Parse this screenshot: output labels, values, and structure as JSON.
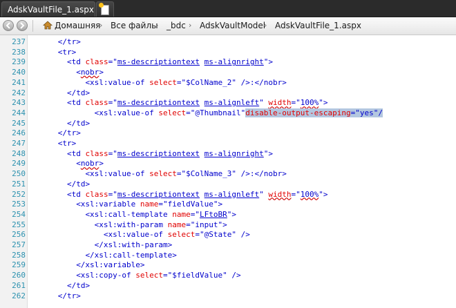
{
  "tabs": {
    "active_label": "AdskVaultFile_1.aspx *"
  },
  "breadcrumb": {
    "items": [
      "Домашняя",
      "Все файлы",
      "_bdc",
      "AdskVaultModel",
      "AdskVaultFile_1.aspx"
    ]
  },
  "colors": {
    "tag": "#0000cc",
    "attribute": "#e00000",
    "line_number": "#2b91af",
    "selection": "#b3c7e0"
  },
  "editor": {
    "lines": [
      {
        "n": "237",
        "segs": [
          [
            "t",
            "</tr>"
          ]
        ]
      },
      {
        "n": "238",
        "segs": [
          [
            "t",
            "<tr>"
          ]
        ]
      },
      {
        "n": "239",
        "segs": [
          [
            "t",
            "<td "
          ],
          [
            "a",
            "class"
          ],
          [
            "t",
            "=\""
          ],
          [
            "vu",
            "ms-descriptiontext"
          ],
          [
            "v",
            " "
          ],
          [
            "vu",
            "ms-alignright"
          ],
          [
            "t",
            "\">"
          ]
        ]
      },
      {
        "n": "240",
        "segs": [
          [
            "t",
            "<"
          ],
          [
            "tq",
            "nobr"
          ],
          [
            "t",
            ">"
          ]
        ]
      },
      {
        "n": "241",
        "segs": [
          [
            "t",
            "<xsl:value-of "
          ],
          [
            "a",
            "select"
          ],
          [
            "t",
            "=\""
          ],
          [
            "v",
            "$ColName_2"
          ],
          [
            "t",
            "\" />:</nobr>"
          ]
        ]
      },
      {
        "n": "242",
        "segs": [
          [
            "t",
            "</td>"
          ]
        ]
      },
      {
        "n": "243",
        "segs": [
          [
            "t",
            "<td "
          ],
          [
            "a",
            "class"
          ],
          [
            "t",
            "=\""
          ],
          [
            "vu",
            "ms-descriptiontext"
          ],
          [
            "v",
            " "
          ],
          [
            "vu",
            "ms-alignleft"
          ],
          [
            "t",
            "\" "
          ],
          [
            "aq",
            "width"
          ],
          [
            "t",
            "=\""
          ],
          [
            "vq",
            "100%"
          ],
          [
            "t",
            "\">"
          ]
        ]
      },
      {
        "n": "244",
        "segs": [
          [
            "t",
            "<xsl:value-of "
          ],
          [
            "a",
            "select"
          ],
          [
            "t",
            "=\""
          ],
          [
            "v",
            "@Thumbnail"
          ],
          [
            "t",
            "\""
          ],
          [
            "as",
            "disable-output-escaping"
          ],
          [
            "ts",
            "=\""
          ],
          [
            "vs",
            "yes"
          ],
          [
            "ts",
            "\"/"
          ]
        ]
      },
      {
        "n": "245",
        "segs": [
          [
            "t",
            "</td>"
          ]
        ]
      },
      {
        "n": "246",
        "segs": [
          [
            "t",
            "</tr>"
          ]
        ]
      },
      {
        "n": "247",
        "segs": [
          [
            "t",
            "<tr>"
          ]
        ]
      },
      {
        "n": "248",
        "segs": [
          [
            "t",
            "<td "
          ],
          [
            "a",
            "class"
          ],
          [
            "t",
            "=\""
          ],
          [
            "vu",
            "ms-descriptiontext"
          ],
          [
            "v",
            " "
          ],
          [
            "vu",
            "ms-alignright"
          ],
          [
            "t",
            "\">"
          ]
        ]
      },
      {
        "n": "249",
        "segs": [
          [
            "t",
            "<"
          ],
          [
            "tq",
            "nobr"
          ],
          [
            "t",
            ">"
          ]
        ]
      },
      {
        "n": "250",
        "segs": [
          [
            "t",
            "<xsl:value-of "
          ],
          [
            "a",
            "select"
          ],
          [
            "t",
            "=\""
          ],
          [
            "v",
            "$ColName_3"
          ],
          [
            "t",
            "\" />:</nobr>"
          ]
        ]
      },
      {
        "n": "251",
        "segs": [
          [
            "t",
            "</td>"
          ]
        ]
      },
      {
        "n": "252",
        "segs": [
          [
            "t",
            "<td "
          ],
          [
            "a",
            "class"
          ],
          [
            "t",
            "=\""
          ],
          [
            "vu",
            "ms-descriptiontext"
          ],
          [
            "v",
            " "
          ],
          [
            "vu",
            "ms-alignleft"
          ],
          [
            "t",
            "\" "
          ],
          [
            "aq",
            "width"
          ],
          [
            "t",
            "=\""
          ],
          [
            "vq",
            "100%"
          ],
          [
            "t",
            "\">"
          ]
        ]
      },
      {
        "n": "253",
        "segs": [
          [
            "t",
            "<xsl:variable "
          ],
          [
            "a",
            "name"
          ],
          [
            "t",
            "=\""
          ],
          [
            "v",
            "fieldValue"
          ],
          [
            "t",
            "\">"
          ]
        ]
      },
      {
        "n": "254",
        "segs": [
          [
            "t",
            "<xsl:call-template "
          ],
          [
            "a",
            "name"
          ],
          [
            "t",
            "=\""
          ],
          [
            "vu",
            "LFtoBR"
          ],
          [
            "t",
            "\">"
          ]
        ]
      },
      {
        "n": "255",
        "segs": [
          [
            "t",
            "<xsl:with-param "
          ],
          [
            "a",
            "name"
          ],
          [
            "t",
            "=\""
          ],
          [
            "v",
            "input"
          ],
          [
            "t",
            "\">"
          ]
        ]
      },
      {
        "n": "256",
        "segs": [
          [
            "t",
            "<xsl:value-of "
          ],
          [
            "a",
            "select"
          ],
          [
            "t",
            "=\""
          ],
          [
            "v",
            "@State"
          ],
          [
            "t",
            "\" />"
          ]
        ]
      },
      {
        "n": "257",
        "segs": [
          [
            "t",
            "</xsl:with-param>"
          ]
        ]
      },
      {
        "n": "258",
        "segs": [
          [
            "t",
            "</xsl:call-template>"
          ]
        ]
      },
      {
        "n": "259",
        "segs": [
          [
            "t",
            "</xsl:variable>"
          ]
        ]
      },
      {
        "n": "260",
        "segs": [
          [
            "t",
            "<xsl:copy-of "
          ],
          [
            "a",
            "select"
          ],
          [
            "t",
            "=\""
          ],
          [
            "v",
            "$fieldValue"
          ],
          [
            "t",
            "\" />"
          ]
        ]
      },
      {
        "n": "261",
        "segs": [
          [
            "t",
            "</td>"
          ]
        ]
      },
      {
        "n": "262",
        "segs": [
          [
            "t",
            "</tr>"
          ]
        ]
      }
    ]
  }
}
